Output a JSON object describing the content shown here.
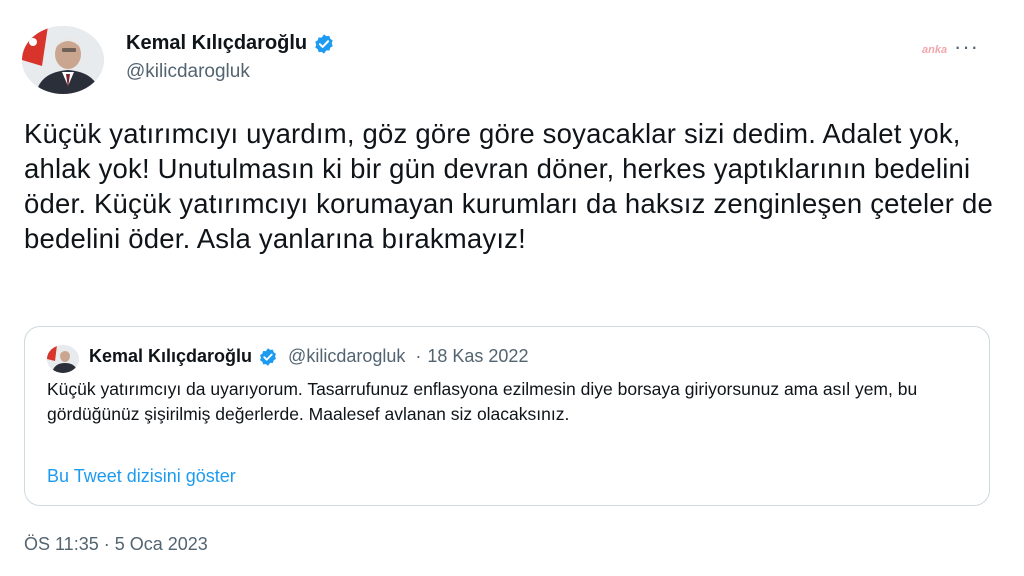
{
  "author": {
    "name": "Kemal Kılıçdaroğlu",
    "handle": "@kilicdarogluk",
    "verified": true
  },
  "watermark": "anka",
  "menu_icon": "more-horizontal-icon",
  "tweet_text": "Küçük yatırımcıyı uyardım, göz göre göre soyacaklar sizi dedim. Adalet yok, ahlak yok! Unutulmasın ki bir gün devran döner, herkes yaptıklarının bedelini öder. Küçük yatırımcıyı korumayan kurumları da haksız zenginleşen çeteler de bedelini öder. Asla yanlarına bırakmayız!",
  "quoted": {
    "name": "Kemal Kılıçdaroğlu",
    "handle": "@kilicdarogluk",
    "separator": "·",
    "date": "18 Kas 2022",
    "text": "Küçük yatırımcıyı da uyarıyorum. Tasarrufunuz enflasyona ezilmesin diye borsaya giriyorsunuz ama asıl yem, bu gördüğünüz şişirilmiş değerlerde. Maalesef avlanan siz olacaksınız.",
    "thread_link": "Bu Tweet dizisini göster"
  },
  "timestamp": "ÖS 11:35 · 5 Oca 2023",
  "colors": {
    "verified": "#1d9bf0",
    "link": "#1d9bf0",
    "secondary_text": "#536471",
    "border": "#cfd9de"
  }
}
